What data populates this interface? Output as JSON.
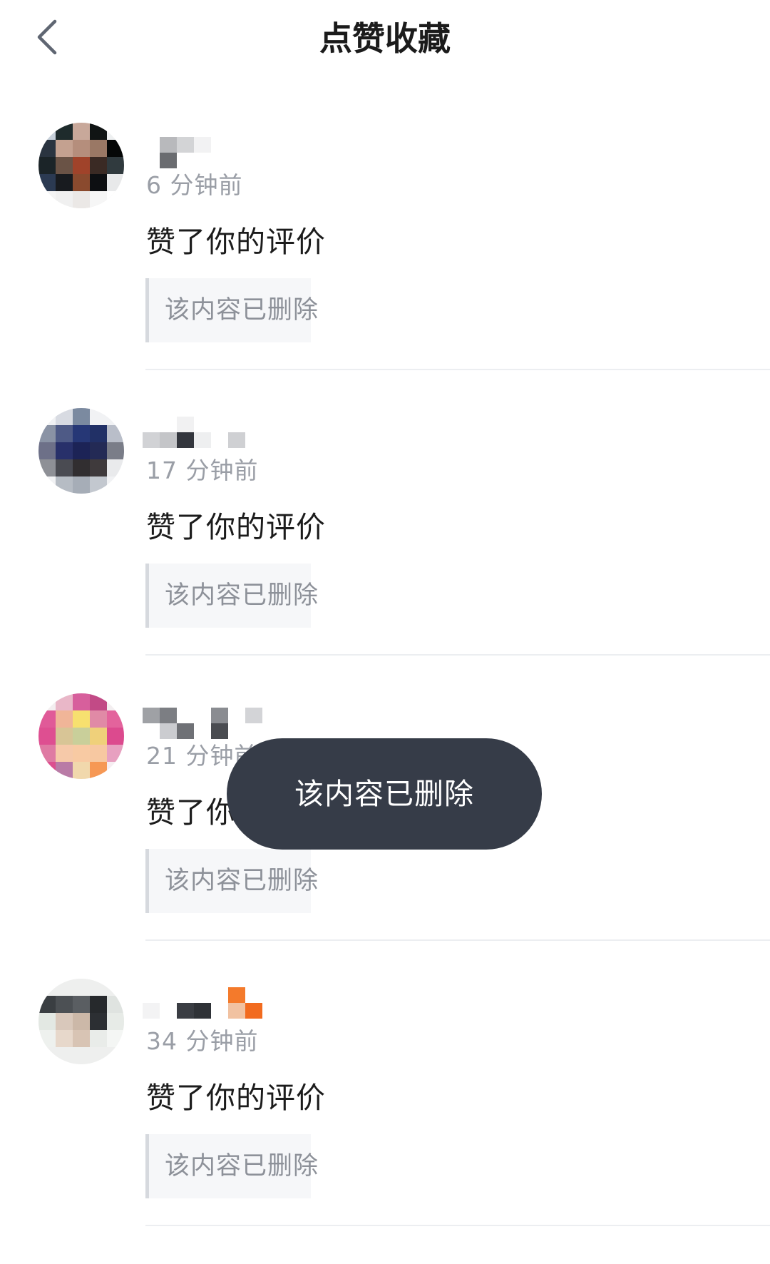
{
  "header": {
    "title": "点赞收藏",
    "back_icon": "chevron-left-icon"
  },
  "items": [
    {
      "timestamp": "6 分钟前",
      "action": "赞了你的评价",
      "quoted": "该内容已删除"
    },
    {
      "timestamp": "17 分钟前",
      "action": "赞了你的评价",
      "quoted": "该内容已删除"
    },
    {
      "timestamp": "21 分钟前",
      "action": "赞了你的评价",
      "quoted": "该内容已删除"
    },
    {
      "timestamp": "34 分钟前",
      "action": "赞了你的评价",
      "quoted": "该内容已删除"
    }
  ],
  "toast": {
    "message": "该内容已删除"
  },
  "colors": {
    "toast_background": "#363c48",
    "timestamp": "#9a9ea6",
    "quoted_text": "#8d9199",
    "card_background": "#f6f7f9"
  }
}
